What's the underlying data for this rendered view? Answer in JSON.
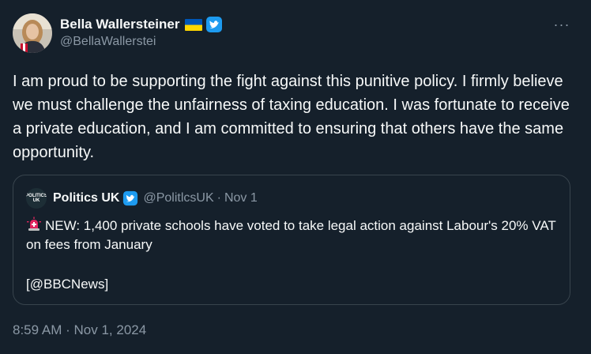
{
  "author": {
    "display_name": "Bella Wallersteiner",
    "handle": "@BellaWallerstei",
    "flag_icon": "ukraine-flag-icon",
    "verified_icon": "verified-badge-icon"
  },
  "more_menu": {
    "label": "···",
    "icon": "more-options-icon"
  },
  "tweet": {
    "text": "I am proud to be supporting the fight against this punitive policy. I firmly believe we must challenge the unfairness of taxing education. I was fortunate to receive a private education, and I am committed to ensuring that others have the same opportunity."
  },
  "quoted_tweet": {
    "avatar_text": "POLITICS UK",
    "display_name": "Politics UK",
    "handle": "@PolitlcsUK",
    "separator": "·",
    "date": "Nov 1",
    "text": "NEW: 1,400 private schools have voted to take legal action against Labour's 20% VAT on fees from January",
    "source": "[@BBCNews]",
    "siren_icon": "siren-icon"
  },
  "footer": {
    "time": "8:59 AM",
    "separator": "·",
    "date": "Nov 1, 2024"
  },
  "colors": {
    "background": "#15202b",
    "text": "#f7f9f9",
    "secondary_text": "#8b98a5",
    "border": "#38444d",
    "verified": "#1d9bf0"
  }
}
